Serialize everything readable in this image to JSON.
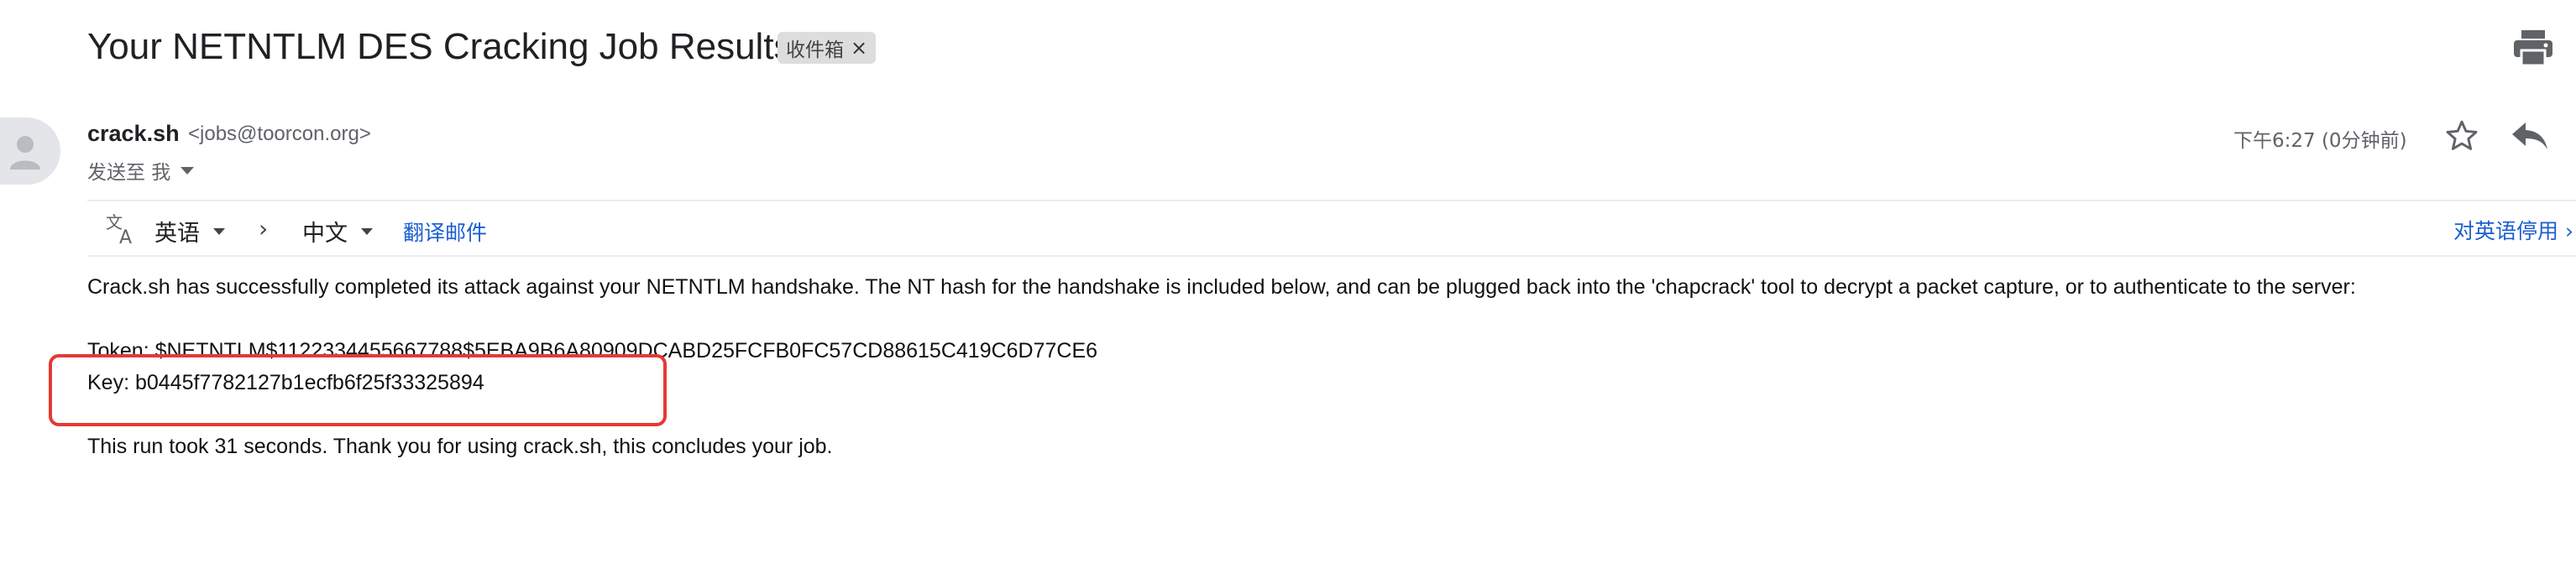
{
  "email": {
    "subject": "Your NETNTLM DES Cracking Job Results",
    "label_chip": "收件箱",
    "label_remove_glyph": "×",
    "sender": {
      "name": "crack.sh",
      "email": "<jobs@toorcon.org>"
    },
    "recipient_line": "发送至 我",
    "timestamp": "下午6:27 (0分钟前)",
    "body": {
      "intro": "Crack.sh has successfully completed its attack against your NETNTLM handshake. The NT hash for the handshake is included below, and can be plugged back into the 'chapcrack' tool to decrypt a packet capture, or to authenticate to the server:",
      "token": "Token: $NETNTLM$1122334455667788$5EBA9B6A80909DCABD25FCFB0FC57CD88615C419C6D77CE6",
      "key": "Key: b0445f7782127b1ecfb6f25f33325894",
      "closing": "This run took 31 seconds. Thank you for using crack.sh, this concludes your job."
    }
  },
  "translate_bar": {
    "from_language": "英语",
    "arrow_glyph": "›",
    "to_language": "中文",
    "translate_link": "翻译邮件",
    "disable_link": "对英语停用",
    "disable_arrow": "›"
  },
  "icons": {
    "print": "print-icon",
    "star": "star-icon",
    "reply": "reply-icon",
    "translate": "translate-icon",
    "avatar": "avatar-icon"
  },
  "colors": {
    "link_blue": "#1a5fcf",
    "highlight_red": "#e53935",
    "chip_bg": "#dddddd"
  }
}
